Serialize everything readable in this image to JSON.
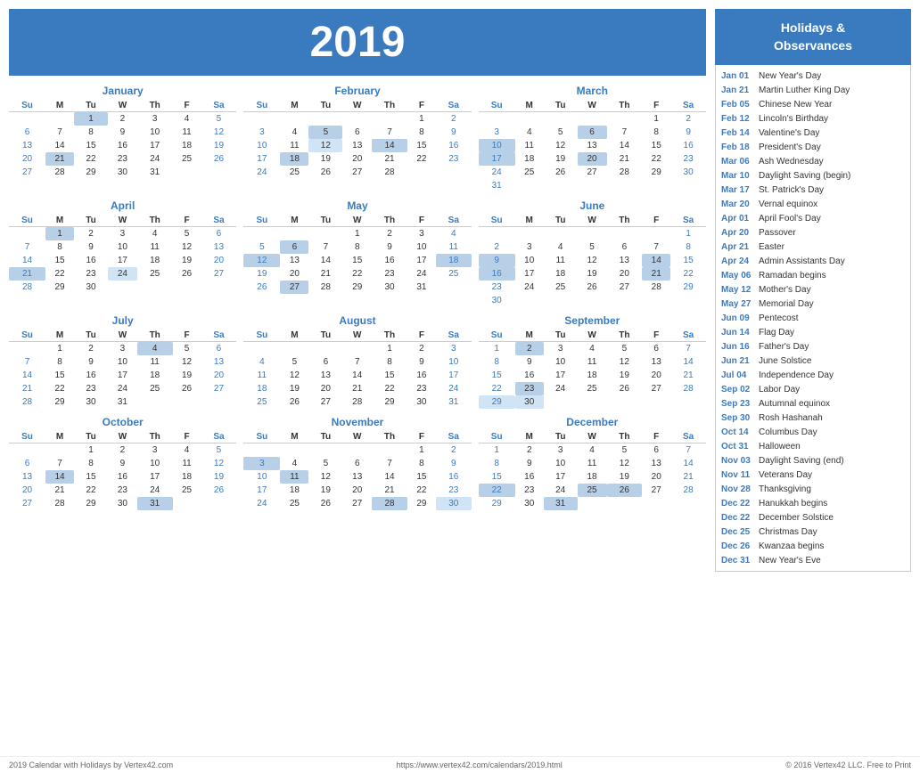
{
  "header": {
    "year": "2019"
  },
  "sidebar": {
    "title": "Holidays &\nObservances",
    "holidays": [
      {
        "date": "Jan 01",
        "name": "New Year's Day"
      },
      {
        "date": "Jan 21",
        "name": "Martin Luther King Day"
      },
      {
        "date": "Feb 05",
        "name": "Chinese New Year"
      },
      {
        "date": "Feb 12",
        "name": "Lincoln's Birthday"
      },
      {
        "date": "Feb 14",
        "name": "Valentine's Day"
      },
      {
        "date": "Feb 18",
        "name": "President's Day"
      },
      {
        "date": "Mar 06",
        "name": "Ash Wednesday"
      },
      {
        "date": "Mar 10",
        "name": "Daylight Saving (begin)"
      },
      {
        "date": "Mar 17",
        "name": "St. Patrick's Day"
      },
      {
        "date": "Mar 20",
        "name": "Vernal equinox"
      },
      {
        "date": "Apr 01",
        "name": "April Fool's Day"
      },
      {
        "date": "Apr 20",
        "name": "Passover"
      },
      {
        "date": "Apr 21",
        "name": "Easter"
      },
      {
        "date": "Apr 24",
        "name": "Admin Assistants Day"
      },
      {
        "date": "May 06",
        "name": "Ramadan begins"
      },
      {
        "date": "May 12",
        "name": "Mother's Day"
      },
      {
        "date": "May 27",
        "name": "Memorial Day"
      },
      {
        "date": "Jun 09",
        "name": "Pentecost"
      },
      {
        "date": "Jun 14",
        "name": "Flag Day"
      },
      {
        "date": "Jun 16",
        "name": "Father's Day"
      },
      {
        "date": "Jun 21",
        "name": "June Solstice"
      },
      {
        "date": "Jul 04",
        "name": "Independence Day"
      },
      {
        "date": "Sep 02",
        "name": "Labor Day"
      },
      {
        "date": "Sep 23",
        "name": "Autumnal equinox"
      },
      {
        "date": "Sep 30",
        "name": "Rosh Hashanah"
      },
      {
        "date": "Oct 14",
        "name": "Columbus Day"
      },
      {
        "date": "Oct 31",
        "name": "Halloween"
      },
      {
        "date": "Nov 03",
        "name": "Daylight Saving (end)"
      },
      {
        "date": "Nov 11",
        "name": "Veterans Day"
      },
      {
        "date": "Nov 28",
        "name": "Thanksgiving"
      },
      {
        "date": "Dec 22",
        "name": "Hanukkah begins"
      },
      {
        "date": "Dec 22",
        "name": "December Solstice"
      },
      {
        "date": "Dec 25",
        "name": "Christmas Day"
      },
      {
        "date": "Dec 26",
        "name": "Kwanzaa begins"
      },
      {
        "date": "Dec 31",
        "name": "New Year's Eve"
      }
    ]
  },
  "footer": {
    "left": "2019 Calendar with Holidays by Vertex42.com",
    "center": "https://www.vertex42.com/calendars/2019.html",
    "right": "© 2016 Vertex42 LLC. Free to Print"
  }
}
